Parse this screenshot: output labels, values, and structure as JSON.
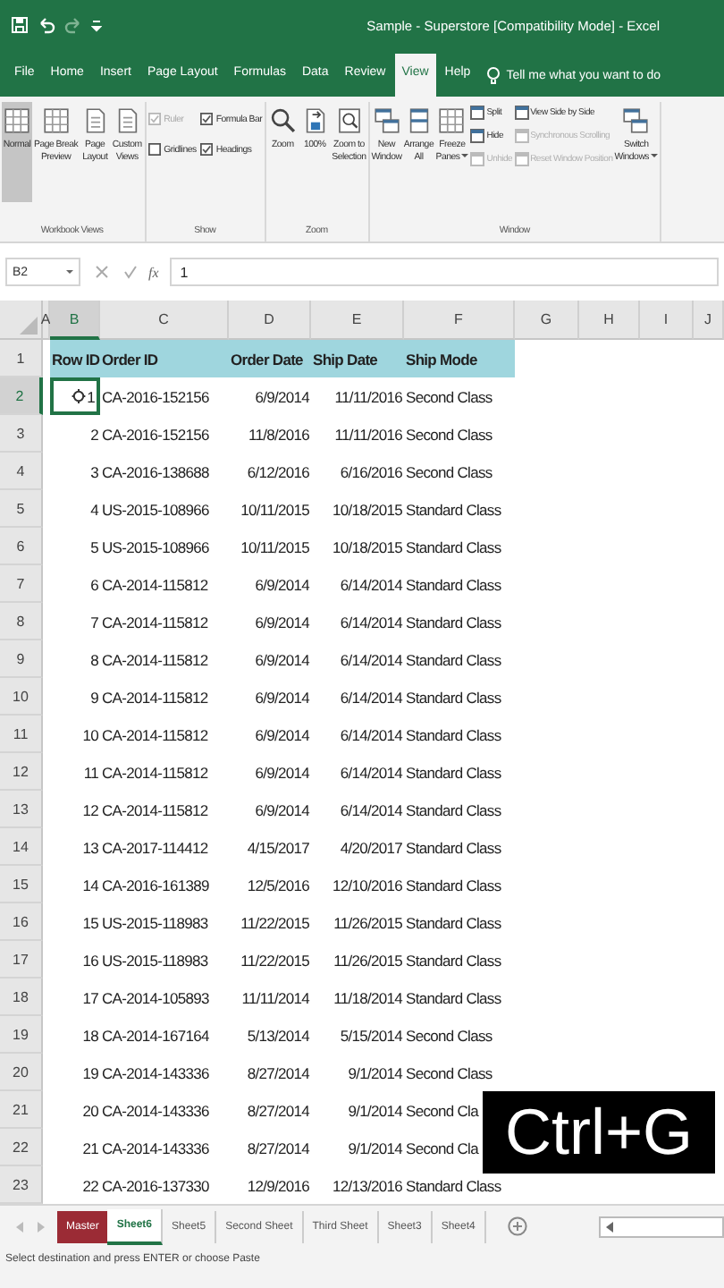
{
  "window": {
    "title": "Sample - Superstore  [Compatibility Mode]  -  Excel"
  },
  "menu_tabs": [
    {
      "label": "File",
      "selected": false
    },
    {
      "label": "Home",
      "selected": false
    },
    {
      "label": "Insert",
      "selected": false
    },
    {
      "label": "Page Layout",
      "selected": false
    },
    {
      "label": "Formulas",
      "selected": false
    },
    {
      "label": "Data",
      "selected": false
    },
    {
      "label": "Review",
      "selected": false
    },
    {
      "label": "View",
      "selected": true
    },
    {
      "label": "Help",
      "selected": false
    }
  ],
  "tell_me": {
    "placeholder": "Tell me what you want to do"
  },
  "ribbon": {
    "groups": [
      {
        "label": "Workbook Views",
        "items": [
          {
            "kind": "large",
            "label": "Normal",
            "selected": true
          },
          {
            "kind": "large",
            "label": "Page Break\nPreview",
            "selected": false
          },
          {
            "kind": "large",
            "label": "Page\nLayout",
            "selected": false
          },
          {
            "kind": "large",
            "label": "Custom\nViews",
            "selected": false
          }
        ]
      },
      {
        "label": "Show",
        "items": [
          {
            "kind": "check",
            "label": "Ruler",
            "checked": true,
            "disabled": true
          },
          {
            "kind": "check",
            "label": "Formula Bar",
            "checked": true,
            "disabled": false
          },
          {
            "kind": "check",
            "label": "Gridlines",
            "checked": false,
            "disabled": false
          },
          {
            "kind": "check",
            "label": "Headings",
            "checked": true,
            "disabled": false
          }
        ]
      },
      {
        "label": "Zoom",
        "items": [
          {
            "kind": "large",
            "label": "Zoom"
          },
          {
            "kind": "large",
            "label": "100%"
          },
          {
            "kind": "large",
            "label": "Zoom to\nSelection"
          }
        ]
      },
      {
        "label": "Window",
        "items": [
          {
            "kind": "large",
            "label": "New\nWindow"
          },
          {
            "kind": "large",
            "label": "Arrange\nAll"
          },
          {
            "kind": "large",
            "label": "Freeze\nPanes",
            "dropdown": true
          },
          {
            "kind": "stack",
            "items": [
              {
                "label": "Split",
                "disabled": false
              },
              {
                "label": "Hide",
                "disabled": false
              },
              {
                "label": "Unhide",
                "disabled": true
              }
            ]
          },
          {
            "kind": "stack",
            "items": [
              {
                "label": "View Side by Side",
                "disabled": false
              },
              {
                "label": "Synchronous Scrolling",
                "disabled": true
              },
              {
                "label": "Reset Window Position",
                "disabled": true
              }
            ]
          },
          {
            "kind": "large",
            "label": "Switch\nWindows",
            "dropdown": true
          }
        ]
      }
    ]
  },
  "formula_bar": {
    "name_box": "B2",
    "function_label": "fx",
    "value": "1"
  },
  "sheet": {
    "columns": [
      {
        "label": "A",
        "selected": false
      },
      {
        "label": "B",
        "selected": true
      },
      {
        "label": "C",
        "selected": false
      },
      {
        "label": "D",
        "selected": false
      },
      {
        "label": "E",
        "selected": false
      },
      {
        "label": "F",
        "selected": false
      },
      {
        "label": "G",
        "selected": false
      },
      {
        "label": "H",
        "selected": false
      },
      {
        "label": "I",
        "selected": false
      },
      {
        "label": "J",
        "selected": false
      }
    ],
    "rows": [
      {
        "number": "1",
        "selected": false,
        "kind": "header",
        "cells": [
          "",
          "Row ID",
          "Order ID",
          "Order Date",
          "Ship Date",
          "Ship Mode"
        ]
      },
      {
        "number": "2",
        "selected": true,
        "kind": "data",
        "cells": [
          "",
          "1",
          "CA-2016-152156",
          "6/9/2014",
          "11/11/2016",
          "Second Class"
        ]
      },
      {
        "number": "3",
        "selected": false,
        "kind": "data",
        "cells": [
          "",
          "2",
          "CA-2016-152156",
          "11/8/2016",
          "11/11/2016",
          "Second Class"
        ]
      },
      {
        "number": "4",
        "selected": false,
        "kind": "data",
        "cells": [
          "",
          "3",
          "CA-2016-138688",
          "6/12/2016",
          "6/16/2016",
          "Second Class"
        ]
      },
      {
        "number": "5",
        "selected": false,
        "kind": "data",
        "cells": [
          "",
          "4",
          "US-2015-108966",
          "10/11/2015",
          "10/18/2015",
          "Standard Class"
        ]
      },
      {
        "number": "6",
        "selected": false,
        "kind": "data",
        "cells": [
          "",
          "5",
          "US-2015-108966",
          "10/11/2015",
          "10/18/2015",
          "Standard Class"
        ]
      },
      {
        "number": "7",
        "selected": false,
        "kind": "data",
        "cells": [
          "",
          "6",
          "CA-2014-115812",
          "6/9/2014",
          "6/14/2014",
          "Standard Class"
        ]
      },
      {
        "number": "8",
        "selected": false,
        "kind": "data",
        "cells": [
          "",
          "7",
          "CA-2014-115812",
          "6/9/2014",
          "6/14/2014",
          "Standard Class"
        ]
      },
      {
        "number": "9",
        "selected": false,
        "kind": "data",
        "cells": [
          "",
          "8",
          "CA-2014-115812",
          "6/9/2014",
          "6/14/2014",
          "Standard Class"
        ]
      },
      {
        "number": "10",
        "selected": false,
        "kind": "data",
        "cells": [
          "",
          "9",
          "CA-2014-115812",
          "6/9/2014",
          "6/14/2014",
          "Standard Class"
        ]
      },
      {
        "number": "11",
        "selected": false,
        "kind": "data",
        "cells": [
          "",
          "10",
          "CA-2014-115812",
          "6/9/2014",
          "6/14/2014",
          "Standard Class"
        ]
      },
      {
        "number": "12",
        "selected": false,
        "kind": "data",
        "cells": [
          "",
          "11",
          "CA-2014-115812",
          "6/9/2014",
          "6/14/2014",
          "Standard Class"
        ]
      },
      {
        "number": "13",
        "selected": false,
        "kind": "data",
        "cells": [
          "",
          "12",
          "CA-2014-115812",
          "6/9/2014",
          "6/14/2014",
          "Standard Class"
        ]
      },
      {
        "number": "14",
        "selected": false,
        "kind": "data",
        "cells": [
          "",
          "13",
          "CA-2017-114412",
          "4/15/2017",
          "4/20/2017",
          "Standard Class"
        ]
      },
      {
        "number": "15",
        "selected": false,
        "kind": "data",
        "cells": [
          "",
          "14",
          "CA-2016-161389",
          "12/5/2016",
          "12/10/2016",
          "Standard Class"
        ]
      },
      {
        "number": "16",
        "selected": false,
        "kind": "data",
        "cells": [
          "",
          "15",
          "US-2015-118983",
          "11/22/2015",
          "11/26/2015",
          "Standard Class"
        ]
      },
      {
        "number": "17",
        "selected": false,
        "kind": "data",
        "cells": [
          "",
          "16",
          "US-2015-118983",
          "11/22/2015",
          "11/26/2015",
          "Standard Class"
        ]
      },
      {
        "number": "18",
        "selected": false,
        "kind": "data",
        "cells": [
          "",
          "17",
          "CA-2014-105893",
          "11/11/2014",
          "11/18/2014",
          "Standard Class"
        ]
      },
      {
        "number": "19",
        "selected": false,
        "kind": "data",
        "cells": [
          "",
          "18",
          "CA-2014-167164",
          "5/13/2014",
          "5/15/2014",
          "Second Class"
        ]
      },
      {
        "number": "20",
        "selected": false,
        "kind": "data",
        "cells": [
          "",
          "19",
          "CA-2014-143336",
          "8/27/2014",
          "9/1/2014",
          "Second Class"
        ]
      },
      {
        "number": "21",
        "selected": false,
        "kind": "data",
        "cells": [
          "",
          "20",
          "CA-2014-143336",
          "8/27/2014",
          "9/1/2014",
          "Second Cla"
        ]
      },
      {
        "number": "22",
        "selected": false,
        "kind": "data",
        "cells": [
          "",
          "21",
          "CA-2014-143336",
          "8/27/2014",
          "9/1/2014",
          "Second Cla"
        ]
      },
      {
        "number": "23",
        "selected": false,
        "kind": "data",
        "cells": [
          "",
          "22",
          "CA-2016-137330",
          "12/9/2016",
          "12/13/2016",
          "Standard Class"
        ]
      }
    ]
  },
  "sheet_tabs": [
    {
      "label": "Master",
      "selected": false,
      "color": "#9b2b35"
    },
    {
      "label": "Sheet6",
      "selected": true
    },
    {
      "label": "Sheet5",
      "selected": false
    },
    {
      "label": "Second Sheet",
      "selected": false
    },
    {
      "label": "Third Sheet",
      "selected": false
    },
    {
      "label": "Sheet3",
      "selected": false
    },
    {
      "label": "Sheet4",
      "selected": false
    }
  ],
  "status_bar": {
    "message": "Select destination and press ENTER or choose Paste"
  },
  "overlay": {
    "text": "Ctrl+G"
  }
}
